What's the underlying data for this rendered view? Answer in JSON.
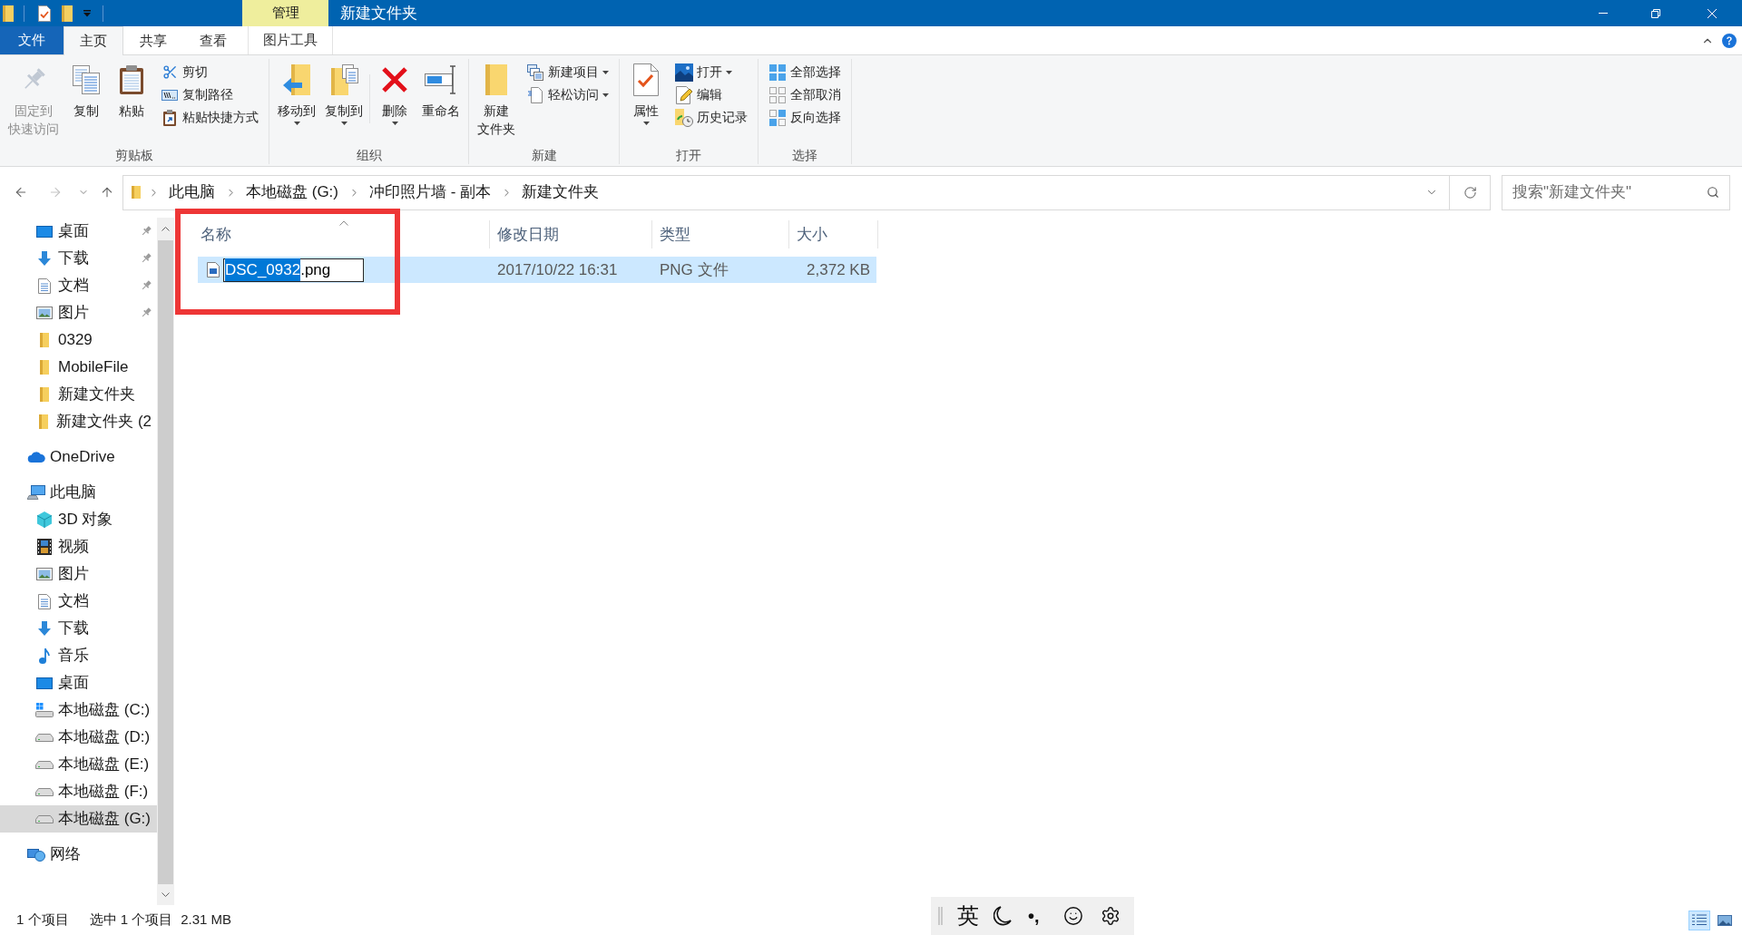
{
  "title_bar": {
    "context_tab": "管理",
    "title": "新建文件夹"
  },
  "ribbon_tabs": [
    {
      "label": "文件",
      "kind": "backstage",
      "selected": false
    },
    {
      "label": "主页",
      "kind": "tab",
      "selected": true
    },
    {
      "label": "共享",
      "kind": "tab",
      "selected": false
    },
    {
      "label": "查看",
      "kind": "tab",
      "selected": false
    },
    {
      "label": "图片工具",
      "kind": "context",
      "selected": false
    }
  ],
  "ribbon_groups": [
    {
      "label": "剪贴板",
      "sections": [
        {
          "items": [
            {
              "kind": "large",
              "label_lines": [
                "固定到",
                "快速访问"
              ],
              "disabled": true,
              "dropdown": false
            },
            {
              "kind": "large",
              "label_lines": [
                "复制"
              ],
              "disabled": false,
              "dropdown": false
            },
            {
              "kind": "large",
              "label_lines": [
                "粘贴"
              ],
              "disabled": false,
              "dropdown": false
            },
            {
              "kind": "small",
              "label": "剪切",
              "disabled": false,
              "dropdown": false
            },
            {
              "kind": "small",
              "label": "复制路径",
              "disabled": false,
              "dropdown": false
            },
            {
              "kind": "small",
              "label": "粘贴快捷方式",
              "disabled": false,
              "dropdown": false
            }
          ]
        }
      ]
    },
    {
      "label": "组织",
      "sections": [
        {
          "items": [
            {
              "kind": "large",
              "label_lines": [
                "移动到"
              ],
              "disabled": false,
              "dropdown": true
            },
            {
              "kind": "large",
              "label_lines": [
                "复制到"
              ],
              "disabled": false,
              "dropdown": true
            }
          ]
        },
        {
          "items": [
            {
              "kind": "large",
              "label_lines": [
                "删除"
              ],
              "disabled": false,
              "dropdown": true
            },
            {
              "kind": "large",
              "label_lines": [
                "重命名"
              ],
              "disabled": false,
              "dropdown": false
            }
          ]
        }
      ]
    },
    {
      "label": "新建",
      "sections": [
        {
          "items": [
            {
              "kind": "large",
              "label_lines": [
                "新建",
                "文件夹"
              ],
              "disabled": false,
              "dropdown": false
            },
            {
              "kind": "small",
              "label": "新建项目",
              "disabled": false,
              "dropdown": true
            },
            {
              "kind": "small",
              "label": "轻松访问",
              "disabled": false,
              "dropdown": true
            }
          ]
        }
      ]
    },
    {
      "label": "打开",
      "sections": [
        {
          "items": [
            {
              "kind": "large",
              "label_lines": [
                "属性"
              ],
              "disabled": false,
              "dropdown": true
            },
            {
              "kind": "small",
              "label": "打开",
              "disabled": false,
              "dropdown": true
            },
            {
              "kind": "small",
              "label": "编辑",
              "disabled": false,
              "dropdown": false
            },
            {
              "kind": "small",
              "label": "历史记录",
              "disabled": false,
              "dropdown": false
            }
          ]
        }
      ]
    },
    {
      "label": "选择",
      "sections": [
        {
          "items": [
            {
              "kind": "small",
              "label": "全部选择",
              "disabled": false,
              "dropdown": false
            },
            {
              "kind": "small",
              "label": "全部取消",
              "disabled": false,
              "dropdown": false
            },
            {
              "kind": "small",
              "label": "反向选择",
              "disabled": false,
              "dropdown": false
            }
          ]
        }
      ]
    }
  ],
  "nav_buttons": [
    {
      "kind": "back",
      "disabled": false
    },
    {
      "kind": "forward",
      "disabled": true
    },
    {
      "kind": "recent",
      "disabled": false
    },
    {
      "kind": "up",
      "disabled": false
    }
  ],
  "address_bar": {
    "breadcrumbs": [
      "此电脑",
      "本地磁盘 (G:)",
      "冲印照片墙 - 副本",
      "新建文件夹"
    ]
  },
  "search": {
    "placeholder": "搜索\"新建文件夹\""
  },
  "sidebar": {
    "quick_access_items": [
      {
        "label": "桌面",
        "kind": "desktop",
        "pinned": true,
        "selected": false
      },
      {
        "label": "下载",
        "kind": "downloads",
        "pinned": true,
        "selected": false
      },
      {
        "label": "文档",
        "kind": "documents",
        "pinned": true,
        "selected": false
      },
      {
        "label": "图片",
        "kind": "pictures",
        "pinned": true,
        "selected": false
      },
      {
        "label": "0329",
        "kind": "folder",
        "pinned": false,
        "selected": false
      },
      {
        "label": "MobileFile",
        "kind": "folder",
        "pinned": false,
        "selected": false
      },
      {
        "label": "新建文件夹",
        "kind": "folder",
        "pinned": false,
        "selected": false
      },
      {
        "label": "新建文件夹 (2",
        "kind": "folder",
        "pinned": false,
        "selected": false
      }
    ],
    "items": [
      {
        "label": "OneDrive",
        "kind": "cloud",
        "selected": false
      },
      {
        "label": "此电脑",
        "kind": "computer",
        "selected": false,
        "children": [
          {
            "label": "3D 对象",
            "kind": "objects3d",
            "selected": false
          },
          {
            "label": "视频",
            "kind": "videos",
            "selected": false
          },
          {
            "label": "图片",
            "kind": "pictures",
            "selected": false
          },
          {
            "label": "文档",
            "kind": "documents",
            "selected": false
          },
          {
            "label": "下载",
            "kind": "downloads",
            "selected": false
          },
          {
            "label": "音乐",
            "kind": "music",
            "selected": false
          },
          {
            "label": "桌面",
            "kind": "desktop",
            "selected": false
          },
          {
            "label": "本地磁盘 (C:)",
            "kind": "system_drive",
            "selected": false
          },
          {
            "label": "本地磁盘 (D:)",
            "kind": "drive",
            "selected": false
          },
          {
            "label": "本地磁盘 (E:)",
            "kind": "drive",
            "selected": false
          },
          {
            "label": "本地磁盘 (F:)",
            "kind": "drive",
            "selected": false
          },
          {
            "label": "本地磁盘 (G:)",
            "kind": "drive",
            "selected": true
          }
        ]
      },
      {
        "label": "网络",
        "kind": "network",
        "selected": false
      }
    ]
  },
  "file_list": {
    "columns": [
      {
        "label": "名称",
        "sorted": true
      },
      {
        "label": "修改日期",
        "sorted": false
      },
      {
        "label": "类型",
        "sorted": false
      },
      {
        "label": "大小",
        "sorted": false
      }
    ],
    "rows": [
      {
        "name_selection": "DSC_0932",
        "name_rest": ".png",
        "renaming": true,
        "selected": true,
        "modified": "2017/10/22 16:31",
        "type": "PNG 文件",
        "size": "2,372 KB"
      }
    ]
  },
  "annotation": {
    "kind": "rectangle"
  },
  "status_bar": {
    "item_count": "1 个项目",
    "selection": "选中 1 个项目",
    "selection_size": "2.31 MB",
    "views": [
      {
        "kind": "details",
        "selected": true
      },
      {
        "kind": "thumbnails",
        "selected": false
      }
    ]
  },
  "ime_toolbar": {
    "mode": "英",
    "punctuation": "•,"
  }
}
